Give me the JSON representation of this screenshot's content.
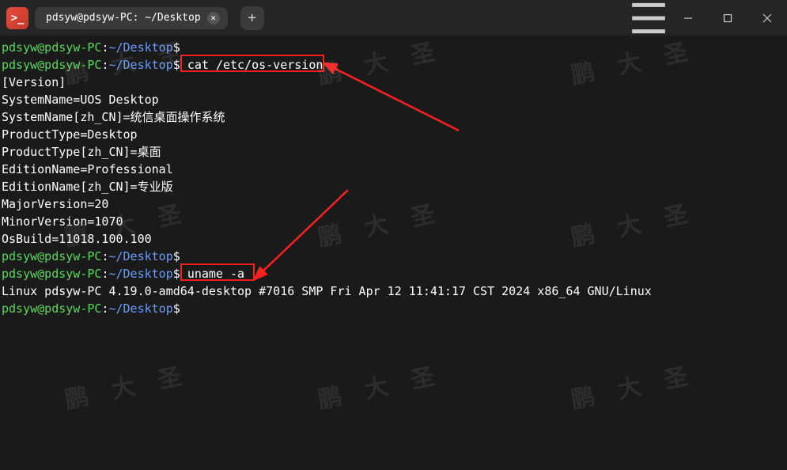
{
  "titlebar": {
    "tab_title": "pdsyw@pdsyw-PC: ~/Desktop",
    "app_icon_text": ">_"
  },
  "prompt": {
    "user_host": "pdsyw@pdsyw-PC",
    "sep": ":",
    "tilde": "~",
    "path": "/Desktop",
    "dollar": "$"
  },
  "commands": {
    "cat": "cat /etc/os-version",
    "uname": "uname -a"
  },
  "output": {
    "version_header": "[Version]",
    "system_name": "SystemName=UOS Desktop",
    "system_name_zh": "SystemName[zh_CN]=统信桌面操作系统",
    "product_type": "ProductType=Desktop",
    "product_type_zh": "ProductType[zh_CN]=桌面",
    "edition_name": "EditionName=Professional",
    "edition_name_zh": "EditionName[zh_CN]=专业版",
    "major_version": "MajorVersion=20",
    "minor_version": "MinorVersion=1070",
    "os_build": "OsBuild=11018.100.100",
    "uname_out": "Linux pdsyw-PC 4.19.0-amd64-desktop #7016 SMP Fri Apr 12 11:41:17 CST 2024 x86_64 GNU/Linux"
  },
  "watermark_text": "鹏 大 圣"
}
